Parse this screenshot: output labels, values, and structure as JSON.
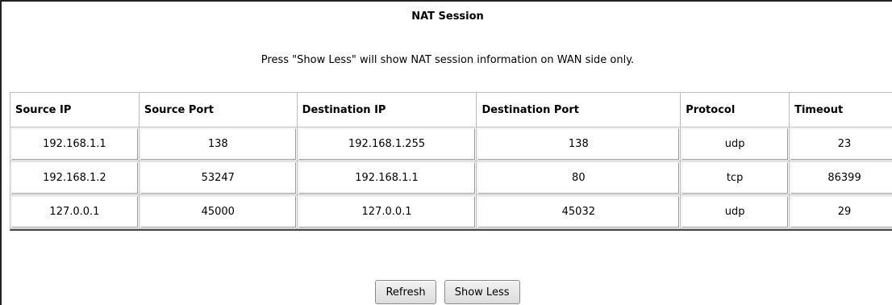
{
  "page": {
    "title": "NAT Session",
    "note": "Press \"Show Less\" will show NAT session information on WAN side only."
  },
  "table": {
    "headers": [
      "Source IP",
      "Source Port",
      "Destination IP",
      "Destination Port",
      "Protocol",
      "Timeout"
    ],
    "rows": [
      [
        "192.168.1.1",
        "138",
        "192.168.1.255",
        "138",
        "udp",
        "23"
      ],
      [
        "192.168.1.2",
        "53247",
        "192.168.1.1",
        "80",
        "tcp",
        "86399"
      ],
      [
        "127.0.0.1",
        "45000",
        "127.0.0.1",
        "45032",
        "udp",
        "29"
      ]
    ]
  },
  "buttons": {
    "refresh": "Refresh",
    "show_less": "Show Less"
  }
}
